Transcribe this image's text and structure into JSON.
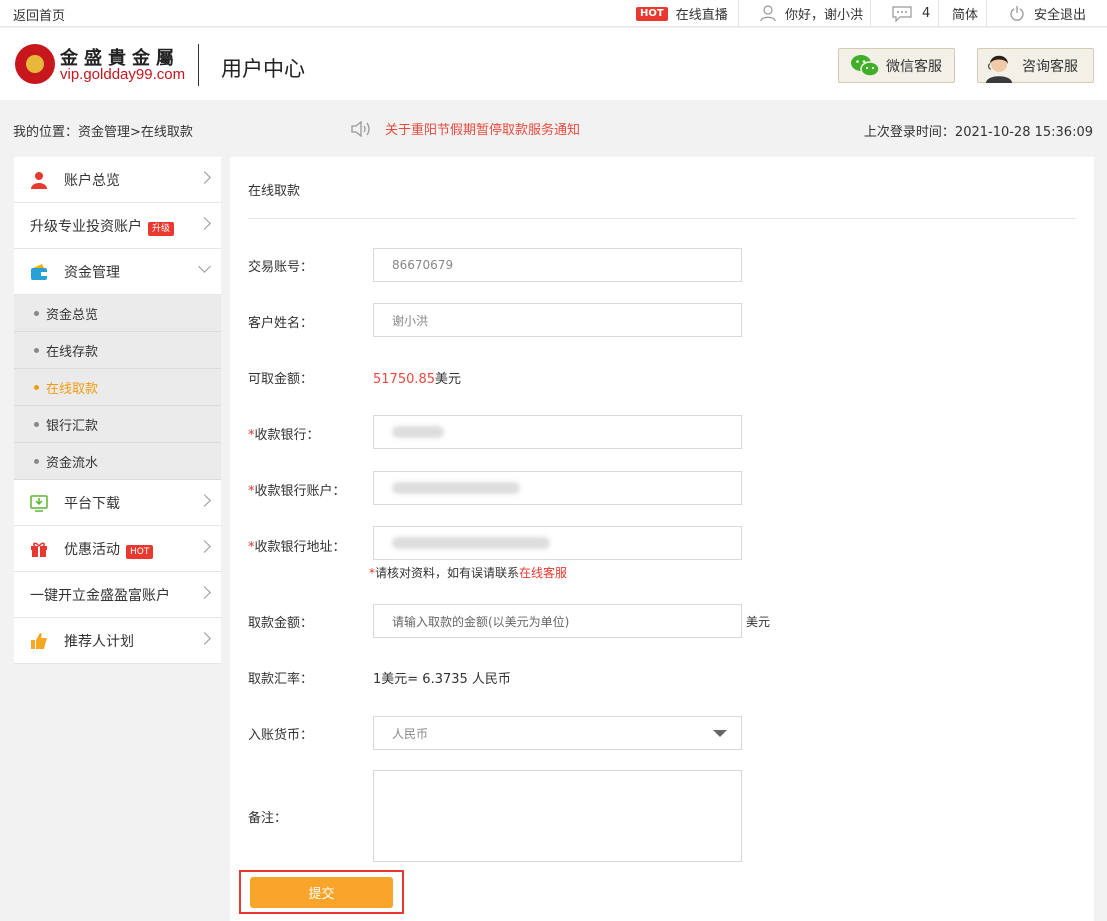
{
  "topbar": {
    "home_link": "返回首页",
    "hot_tag": "HOT",
    "live": "在线直播",
    "greeting": "你好，谢小洪",
    "messages_count": "4",
    "language": "简体",
    "logout": "安全退出"
  },
  "header": {
    "logo_cn": "金盛貴金屬",
    "logo_en": "vip.goldday99.com",
    "title": "用户中心",
    "wechat_service": "微信客服",
    "consult_service": "咨询客服"
  },
  "breadcrumb": "我的位置：资金管理>在线取款",
  "notice": "关于重阳节假期暂停取款服务通知",
  "last_login": "上次登录时间：2021-10-28 15:36:09",
  "sidebar": {
    "items": [
      {
        "label": "账户总览"
      },
      {
        "label": "升级专业投资账户",
        "badge": "升级"
      },
      {
        "label": "资金管理"
      },
      {
        "label": "平台下载"
      },
      {
        "label": "优惠活动",
        "badge": "HOT"
      },
      {
        "label": "一键开立金盛盈富账户"
      },
      {
        "label": "推荐人计划"
      }
    ],
    "sub_items": [
      {
        "label": "资金总览"
      },
      {
        "label": "在线存款"
      },
      {
        "label": "在线取款"
      },
      {
        "label": "银行汇款"
      },
      {
        "label": "资金流水"
      }
    ]
  },
  "form": {
    "title": "在线取款",
    "account_label": "交易账号：",
    "account_value": "86670679",
    "name_label": "客户姓名：",
    "name_value": "谢小洪",
    "available_label": "可取金额：",
    "available_amount": "51750.85",
    "available_unit": "美元",
    "bank_label": "收款银行：",
    "bank_account_label": "收款银行账户：",
    "bank_address_label": "收款银行地址：",
    "verify_note_prefix": "请核对资料，如有误请联系",
    "verify_note_link": "在线客服",
    "withdraw_label": "取款金额：",
    "withdraw_placeholder": "请输入取款的金额(以美元为单位)",
    "withdraw_unit": "美元",
    "rate_label": "取款汇率：",
    "rate_value": "1美元= 6.3735 人民币",
    "currency_label": "入账货币：",
    "currency_value": "人民币",
    "remark_label": "备注：",
    "submit": "提交",
    "required_mark": "*"
  },
  "colors": {
    "accent_red": "#e8382f",
    "submit_orange": "#f9a52b",
    "active_orange": "#f39c12"
  }
}
